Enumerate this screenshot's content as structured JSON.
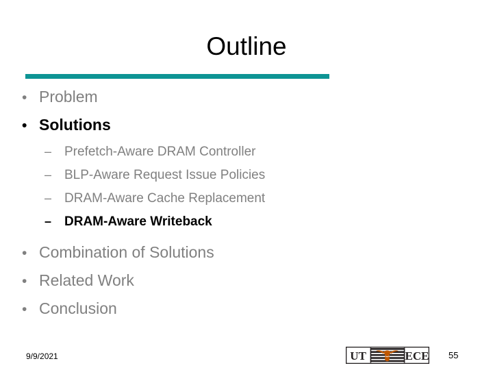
{
  "slide": {
    "title": "Outline",
    "accent_color": "#0d9494",
    "inactive_color": "#808080",
    "active_color": "#000000",
    "background_color": "#ffffff"
  },
  "outline": {
    "items": [
      {
        "level": 1,
        "marker": "•",
        "label": "Problem",
        "active": false
      },
      {
        "level": 1,
        "marker": "•",
        "label": "Solutions",
        "active": true
      },
      {
        "level": 2,
        "marker": "–",
        "label": "Prefetch-Aware DRAM Controller",
        "active": false
      },
      {
        "level": 2,
        "marker": "–",
        "label": "BLP-Aware Request Issue Policies",
        "active": false
      },
      {
        "level": 2,
        "marker": "–",
        "label": "DRAM-Aware Cache Replacement",
        "active": false
      },
      {
        "level": 2,
        "marker": "–",
        "label": "DRAM-Aware Writeback",
        "active": true
      },
      {
        "level": 1,
        "marker": "•",
        "label": "Combination of Solutions",
        "active": false
      },
      {
        "level": 1,
        "marker": "•",
        "label": "Related Work",
        "active": false
      },
      {
        "level": 1,
        "marker": "•",
        "label": "Conclusion",
        "active": false
      }
    ]
  },
  "footer": {
    "date": "9/9/2021",
    "page_number": "55",
    "logo": {
      "left_text": "UT",
      "right_text": "ECE",
      "icon": "longhorn-icon",
      "horn_color": "#bf5700",
      "frame_color": "#231f20"
    }
  }
}
